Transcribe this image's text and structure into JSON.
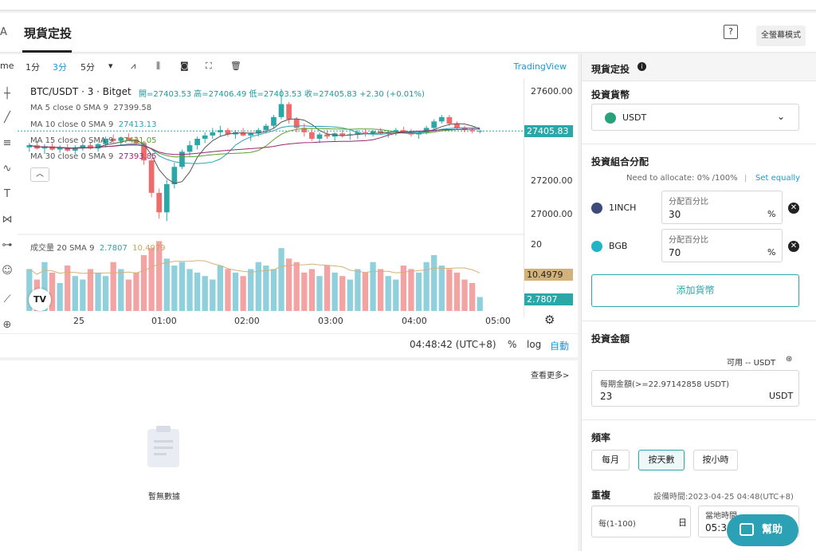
{
  "header": {
    "left_fragment": "A",
    "title": "現貨定投",
    "help_icon": "question-box-icon",
    "fullscreen_label": "全螢幕模式"
  },
  "toolbar": {
    "left_fragment": "me",
    "intervals": [
      "1分",
      "3分",
      "5分"
    ],
    "active_interval": "3分",
    "provider": "TradingView",
    "icons": [
      "chevron-down-icon",
      "indicators-icon",
      "candle-type-icon",
      "camera-icon",
      "fullscreen-icon",
      "trash-icon"
    ]
  },
  "legend": {
    "symbol": "BTC/USDT · 3 · Bitget",
    "ohlc": "開=27403.53 高=27406.49 低=27403.53 收=27405.83 +2.30 (+0.01%)",
    "ma": [
      {
        "label": "MA 5 close 0 SMA 9",
        "value": "27399.58",
        "color": "#555555"
      },
      {
        "label": "MA 10 close 0 SMA 9",
        "value": "27413.13",
        "color": "#2ba0b6"
      },
      {
        "label": "MA 15 close 0 SMA 9",
        "value": "27421.05",
        "color": "#5aa02c"
      },
      {
        "label": "MA 30 close 0 SMA 9",
        "value": "27393.85",
        "color": "#9c2776"
      }
    ],
    "volume": {
      "label": "成交量 20 SMA 9",
      "value1": "2.7807",
      "value2": "10.4979"
    }
  },
  "price_scale": {
    "labels": [
      "27600.00",
      "27400.00",
      "27200.00",
      "27000.00"
    ],
    "current_tag": "27405.83",
    "vol_labels": [
      "20"
    ],
    "vol_tag1": "10.4979",
    "vol_tag2": "2.7807"
  },
  "time_axis": [
    "25",
    "01:00",
    "02:00",
    "03:00",
    "04:00",
    "05:00"
  ],
  "statusbar": {
    "time": "04:48:42 (UTC+8)",
    "pct": "%",
    "log": "log",
    "auto": "自動"
  },
  "chart_data": {
    "type": "candlestick",
    "x": [
      "25",
      "01:00",
      "02:00",
      "03:00",
      "04:00",
      "05:00"
    ],
    "ylim": [
      26950,
      27650
    ],
    "ticks": [
      27000,
      27200,
      27400,
      27600
    ],
    "candles": [
      [
        27330,
        27350,
        27310,
        27340
      ],
      [
        27340,
        27360,
        27320,
        27325
      ],
      [
        27325,
        27345,
        27300,
        27335
      ],
      [
        27335,
        27350,
        27315,
        27320
      ],
      [
        27320,
        27340,
        27305,
        27330
      ],
      [
        27330,
        27345,
        27310,
        27315
      ],
      [
        27315,
        27340,
        27300,
        27330
      ],
      [
        27330,
        27350,
        27315,
        27340
      ],
      [
        27340,
        27355,
        27320,
        27325
      ],
      [
        27325,
        27350,
        27310,
        27345
      ],
      [
        27345,
        27380,
        27330,
        27370
      ],
      [
        27370,
        27390,
        27350,
        27360
      ],
      [
        27360,
        27380,
        27340,
        27375
      ],
      [
        27375,
        27395,
        27360,
        27365
      ],
      [
        27365,
        27380,
        27340,
        27350
      ],
      [
        27350,
        27360,
        27250,
        27270
      ],
      [
        27270,
        27280,
        27100,
        27120
      ],
      [
        27120,
        27140,
        27000,
        27030
      ],
      [
        27030,
        27180,
        26990,
        27160
      ],
      [
        27160,
        27260,
        27140,
        27240
      ],
      [
        27240,
        27320,
        27230,
        27310
      ],
      [
        27310,
        27360,
        27290,
        27340
      ],
      [
        27340,
        27380,
        27320,
        27370
      ],
      [
        27370,
        27400,
        27350,
        27385
      ],
      [
        27385,
        27420,
        27370,
        27400
      ],
      [
        27400,
        27430,
        27380,
        27410
      ],
      [
        27410,
        27420,
        27380,
        27390
      ],
      [
        27390,
        27410,
        27370,
        27400
      ],
      [
        27400,
        27420,
        27380,
        27385
      ],
      [
        27385,
        27400,
        27360,
        27395
      ],
      [
        27395,
        27420,
        27380,
        27410
      ],
      [
        27410,
        27440,
        27395,
        27430
      ],
      [
        27430,
        27480,
        27420,
        27470
      ],
      [
        27470,
        27600,
        27460,
        27530
      ],
      [
        27530,
        27540,
        27440,
        27460
      ],
      [
        27460,
        27470,
        27400,
        27420
      ],
      [
        27420,
        27440,
        27380,
        27400
      ],
      [
        27400,
        27420,
        27360,
        27370
      ],
      [
        27370,
        27400,
        27350,
        27390
      ],
      [
        27390,
        27410,
        27370,
        27380
      ],
      [
        27380,
        27400,
        27360,
        27395
      ],
      [
        27395,
        27410,
        27375,
        27385
      ],
      [
        27385,
        27400,
        27365,
        27390
      ],
      [
        27390,
        27410,
        27370,
        27400
      ],
      [
        27400,
        27415,
        27380,
        27395
      ],
      [
        27395,
        27410,
        27380,
        27405
      ],
      [
        27405,
        27420,
        27390,
        27395
      ],
      [
        27395,
        27410,
        27375,
        27400
      ],
      [
        27400,
        27420,
        27385,
        27410
      ],
      [
        27410,
        27425,
        27395,
        27400
      ],
      [
        27400,
        27415,
        27380,
        27390
      ],
      [
        27390,
        27405,
        27370,
        27400
      ],
      [
        27400,
        27430,
        27390,
        27420
      ],
      [
        27420,
        27460,
        27410,
        27450
      ],
      [
        27450,
        27480,
        27440,
        27470
      ],
      [
        27470,
        27480,
        27430,
        27440
      ],
      [
        27440,
        27450,
        27410,
        27420
      ],
      [
        27420,
        27430,
        27400,
        27410
      ],
      [
        27410,
        27420,
        27395,
        27405
      ],
      [
        27405,
        27410,
        27395,
        27406
      ]
    ],
    "volume": [
      12,
      9,
      14,
      11,
      8,
      13,
      10,
      9,
      12,
      11,
      10,
      14,
      12,
      9,
      11,
      16,
      18,
      20,
      15,
      13,
      14,
      12,
      11,
      10,
      9,
      13,
      12,
      11,
      10,
      12,
      14,
      13,
      12,
      18,
      15,
      14,
      11,
      12,
      10,
      13,
      11,
      10,
      9,
      12,
      11,
      14,
      12,
      10,
      9,
      13,
      12,
      11,
      14,
      16,
      13,
      12,
      11,
      9,
      8,
      4
    ],
    "candle_colors": {
      "up": "#2aa8a8",
      "down": "#ef6b6b"
    },
    "vol_colors": {
      "up": "#8fd0dc",
      "down": "#f4a3a3"
    }
  },
  "lower": {
    "view_more": "查看更多>",
    "empty_text": "暫無數據",
    "empty_icon": "clipboard-icon"
  },
  "right": {
    "title": "現貨定投",
    "invest_coin_label": "投資貨幣",
    "coin": "USDT",
    "portfolio_label": "投資組合分配",
    "need_allocate": "Need to allocate: 0% /100%",
    "set_equally": "Set equally",
    "allocations": [
      {
        "coin": "1INCH",
        "label": "分配百分比",
        "value": "30",
        "unit": "%"
      },
      {
        "coin": "BGB",
        "label": "分配百分比",
        "value": "70",
        "unit": "%"
      }
    ],
    "add_coin": "添加貨幣",
    "amount_label": "投資金額",
    "available": "可用 -- USDT",
    "amount_field_label": "每期金額(>=22.97142858 USDT)",
    "amount_value": "23",
    "amount_unit": "USDT",
    "frequency_label": "頻率",
    "freq_options": [
      "每月",
      "按天數",
      "按小時"
    ],
    "freq_selected": "按天數",
    "repeat_label": "重複",
    "set_time": "設備時間:2023-04-25 04:48(UTC+8)",
    "repeat_placeholder": "每(1-100)",
    "repeat_unit": "日",
    "local_time_label": "當地時間",
    "local_time_value": "05:30",
    "help": "幫助",
    "accent": "#2ca8a8"
  }
}
